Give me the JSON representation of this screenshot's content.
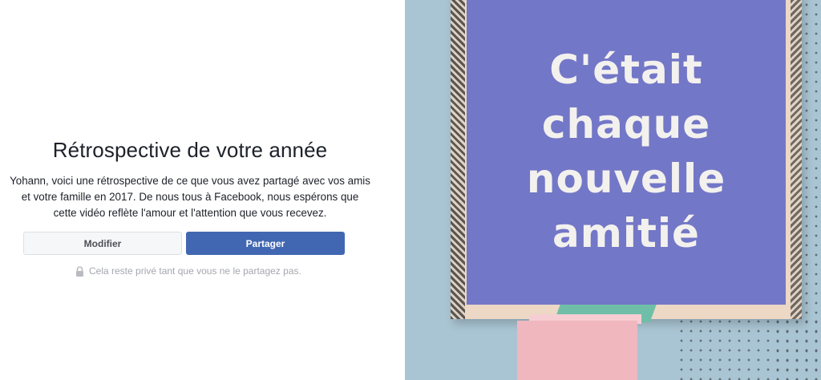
{
  "recap": {
    "title": "Rétrospective de votre année",
    "description": "Yohann, voici une rétrospective de ce que vous avez partagé avec vos amis et votre famille en 2017. De nous tous à Facebook, nous espérons que cette vidéo reflète l'amour et l'attention que vous recevez.",
    "modify_label": "Modifier",
    "share_label": "Partager",
    "privacy_note": "Cela reste privé tant que vous ne le partagez pas."
  },
  "preview": {
    "card_lines": [
      "C'était",
      "chaque",
      "nouvelle",
      "amitié"
    ]
  },
  "colors": {
    "share_button": "#4267b2",
    "card_background": "#7377c7",
    "scene_background": "#a9c4d2"
  },
  "icons": {
    "privacy": "lock-icon"
  }
}
